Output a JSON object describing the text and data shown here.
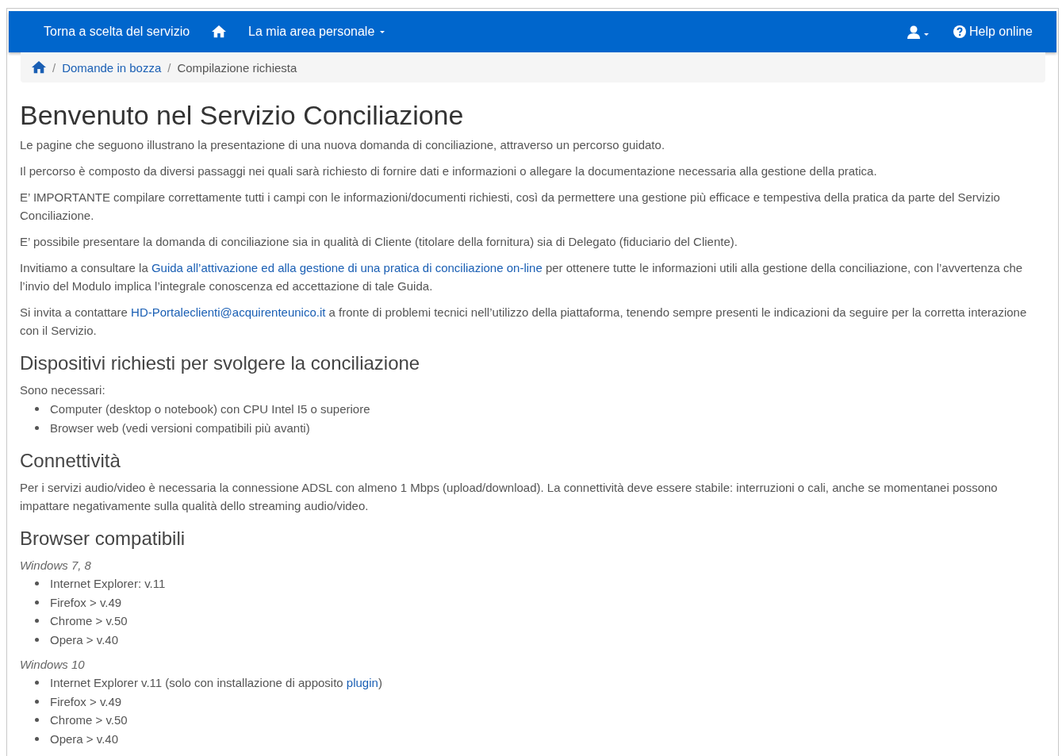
{
  "navbar": {
    "back_link": "Torna a scelta del servizio",
    "menu": "La mia area personale",
    "help": "Help online"
  },
  "breadcrumb": {
    "items": [
      {
        "separator": "/",
        "label": "Domande in bozza",
        "link": true
      },
      {
        "separator": "/",
        "label": "Compilazione richiesta",
        "link": false
      }
    ]
  },
  "title": "Benvenuto nel Servizio Conciliazione",
  "intro": [
    {
      "parts": [
        {
          "text": "Le pagine che seguono illustrano la presentazione di una nuova domanda di conciliazione, attraverso un percorso guidato.",
          "link": false
        }
      ]
    },
    {
      "parts": [
        {
          "text": "Il percorso è composto da diversi passaggi nei quali sarà richiesto di fornire dati e informazioni o allegare la documentazione necessaria alla gestione della pratica.",
          "link": false
        }
      ]
    },
    {
      "parts": [
        {
          "text": "E’ IMPORTANTE compilare correttamente tutti i campi con le informazioni/documenti richiesti, così da permettere una gestione più efficace e tempestiva della pratica da parte del Servizio Conciliazione.",
          "link": false
        }
      ]
    },
    {
      "parts": [
        {
          "text": "E’ possibile presentare la domanda di conciliazione sia in qualità di Cliente (titolare della fornitura) sia di Delegato (fiduciario del Cliente).",
          "link": false
        }
      ]
    },
    {
      "parts": [
        {
          "text": "Invitiamo a consultare la ",
          "link": false
        },
        {
          "text": "Guida all’attivazione ed alla gestione di una pratica di conciliazione on-line",
          "link": true
        },
        {
          "text": " per ottenere tutte le informazioni utili alla gestione della conciliazione, con l’avvertenza che l’invio del Modulo implica l’integrale conoscenza ed accettazione di tale Guida.",
          "link": false
        }
      ]
    },
    {
      "parts": [
        {
          "text": "Si invita a contattare ",
          "link": false
        },
        {
          "text": "HD-Portaleclienti@acquirenteunico.it",
          "link": true
        },
        {
          "text": " a fronte di problemi tecnici nell’utilizzo della piattaforma, tenendo sempre presenti le indicazioni da seguire per la corretta interazione con il Servizio.",
          "link": false
        }
      ]
    }
  ],
  "devices": {
    "heading": "Dispositivi richiesti per svolgere la conciliazione",
    "lead": "Sono necessari:",
    "items": [
      "Computer (desktop o notebook) con CPU Intel I5 o superiore",
      "Browser web (vedi versioni compatibili più avanti)"
    ]
  },
  "connectivity": {
    "heading": "Connettività",
    "text": "Per i servizi audio/video è necessaria la connessione ADSL con almeno 1 Mbps (upload/download). La connettività deve essere stabile: interruzioni o cali, anche se momentanei possono impattare negativamente sulla qualità dello streaming audio/video."
  },
  "browsers": {
    "heading": "Browser compatibili",
    "groups": [
      {
        "os": "Windows 7, 8",
        "items": [
          {
            "parts": [
              {
                "text": "Internet Explorer: v.11",
                "link": false
              }
            ]
          },
          {
            "parts": [
              {
                "text": "Firefox > v.49",
                "link": false
              }
            ]
          },
          {
            "parts": [
              {
                "text": "Chrome > v.50",
                "link": false
              }
            ]
          },
          {
            "parts": [
              {
                "text": "Opera > v.40",
                "link": false
              }
            ]
          }
        ]
      },
      {
        "os": "Windows 10",
        "items": [
          {
            "parts": [
              {
                "text": "Internet Explorer v.11 (solo con installazione di apposito ",
                "link": false
              },
              {
                "text": "plugin",
                "link": true
              },
              {
                "text": ")",
                "link": false
              }
            ]
          },
          {
            "parts": [
              {
                "text": "Firefox > v.49",
                "link": false
              }
            ]
          },
          {
            "parts": [
              {
                "text": "Chrome > v.50",
                "link": false
              }
            ]
          },
          {
            "parts": [
              {
                "text": "Opera > v.40",
                "link": false
              }
            ]
          }
        ]
      }
    ]
  }
}
